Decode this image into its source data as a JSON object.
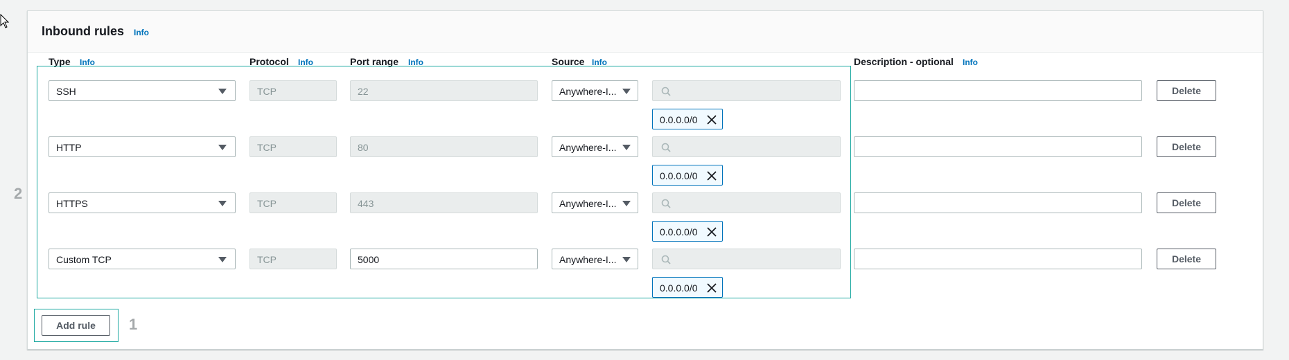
{
  "header": {
    "title": "Inbound rules",
    "info": "Info"
  },
  "columns": {
    "type": {
      "label": "Type",
      "info": "Info"
    },
    "protocol": {
      "label": "Protocol",
      "info": "Info"
    },
    "port_range": {
      "label": "Port range",
      "info": "Info"
    },
    "source": {
      "label": "Source",
      "info": "Info"
    },
    "description": {
      "label": "Description - optional",
      "info": "Info"
    }
  },
  "rules": [
    {
      "type": "SSH",
      "protocol": "TCP",
      "port": "22",
      "port_editable": false,
      "source": "Anywhere-I...",
      "cidr_search_placeholder": "",
      "cidr": "0.0.0.0/0",
      "description": "",
      "delete_label": "Delete"
    },
    {
      "type": "HTTP",
      "protocol": "TCP",
      "port": "80",
      "port_editable": false,
      "source": "Anywhere-I...",
      "cidr_search_placeholder": "",
      "cidr": "0.0.0.0/0",
      "description": "",
      "delete_label": "Delete"
    },
    {
      "type": "HTTPS",
      "protocol": "TCP",
      "port": "443",
      "port_editable": false,
      "source": "Anywhere-I...",
      "cidr_search_placeholder": "",
      "cidr": "0.0.0.0/0",
      "description": "",
      "delete_label": "Delete"
    },
    {
      "type": "Custom TCP",
      "protocol": "TCP",
      "port": "5000",
      "port_editable": true,
      "source": "Anywhere-I...",
      "cidr_search_placeholder": "",
      "cidr": "0.0.0.0/0",
      "description": "",
      "delete_label": "Delete"
    }
  ],
  "add_rule_label": "Add rule",
  "annotations": {
    "rules_marker": "2",
    "add_marker": "1"
  },
  "colors": {
    "accent_link": "#0073bb",
    "highlight_outline": "#1ba8a0",
    "panel_bg": "#ffffff",
    "page_bg": "#f2f3f3"
  }
}
